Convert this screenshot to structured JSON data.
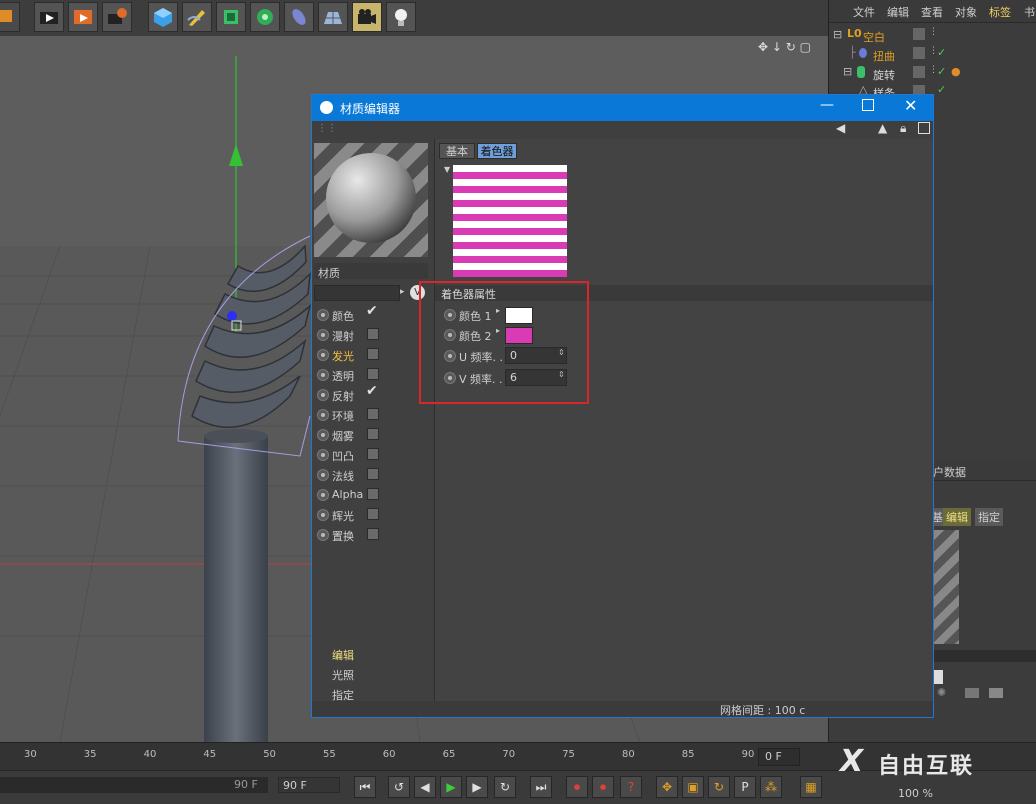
{
  "right_menu": {
    "items": [
      "文件",
      "编辑",
      "查看",
      "对象",
      "标签",
      "书"
    ]
  },
  "objects": [
    {
      "name": "空白",
      "color": "#e0a020"
    },
    {
      "name": "扭曲",
      "color": "#e0a020"
    },
    {
      "name": "旋转",
      "color": "#d8d8d8"
    },
    {
      "name": "样条",
      "color": "#d8d8d8"
    }
  ],
  "attr_panel": {
    "title_partial": "户数据",
    "tabs": [
      "基本",
      "编辑",
      "指定"
    ]
  },
  "material_editor": {
    "title": "材质编辑器",
    "preview_label": "材质",
    "channels": [
      {
        "label": "颜色",
        "checked": true,
        "active": false
      },
      {
        "label": "漫射",
        "checked": false,
        "active": false
      },
      {
        "label": "发光",
        "checked": false,
        "active": true
      },
      {
        "label": "透明",
        "checked": false,
        "active": false
      },
      {
        "label": "反射",
        "checked": true,
        "active": false
      },
      {
        "label": "环境",
        "checked": false,
        "active": false
      },
      {
        "label": "烟雾",
        "checked": false,
        "active": false
      },
      {
        "label": "凹凸",
        "checked": false,
        "active": false
      },
      {
        "label": "法线",
        "checked": false,
        "active": false
      },
      {
        "label": "Alpha",
        "checked": false,
        "active": false
      },
      {
        "label": "辉光",
        "checked": false,
        "active": false
      },
      {
        "label": "置换",
        "checked": false,
        "active": false
      }
    ],
    "sections": [
      "编辑",
      "光照",
      "指定"
    ],
    "tabs": [
      "基本",
      "着色器"
    ],
    "shader_header": "着色器属性",
    "shader_props": {
      "color1": {
        "label": "颜色 1",
        "value": "#ffffff"
      },
      "color2": {
        "label": "颜色 2",
        "value": "#d93bb5"
      },
      "u_freq": {
        "label": "U 频率. .",
        "value": "0"
      },
      "v_freq": {
        "label": "V 频率. .",
        "value": "6"
      }
    },
    "status": "网格间距 : 100 c"
  },
  "timeline": {
    "ticks": [
      "30",
      "35",
      "40",
      "45",
      "50",
      "55",
      "60",
      "65",
      "70",
      "75",
      "80",
      "85",
      "90"
    ],
    "frame_left": "90 F",
    "frame_field": "90 F",
    "frame_right": "0 F",
    "zoom": "100 %"
  },
  "watermark": "自由互联",
  "colors": {
    "accent": "#0a78d7",
    "highlight": "#d9262b",
    "stripe": "#d93bb5"
  }
}
